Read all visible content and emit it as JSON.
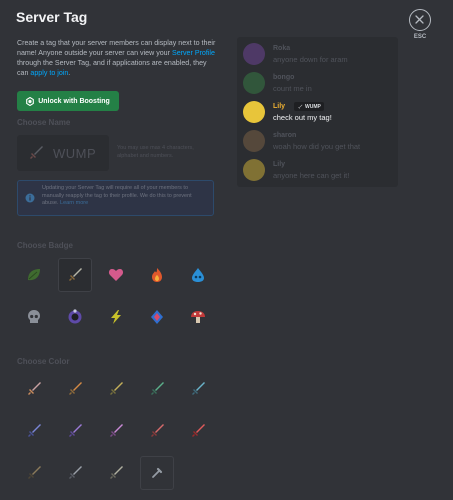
{
  "header": {
    "title": "Server Tag",
    "esc_label": "ESC"
  },
  "description": {
    "part1": "Create a tag that your server members can display next to their name! Anyone outside your server can view your ",
    "link1": "Server Profile",
    "part2": " through the Server Tag, and if applications are enabled, they can ",
    "link2": "apply to join",
    "part3": "."
  },
  "unlock_button": {
    "label": "Unlock with Boosting"
  },
  "choose_name": {
    "label": "Choose Name",
    "tag_text": "WUMP",
    "hint": "You may use max 4 characters, alphabet and numbers."
  },
  "info": {
    "text": "Updating your Server Tag will require all of your members to manually reapply the tag to their profile. We do this to prevent abuse. ",
    "link": "Learn more"
  },
  "choose_badge": {
    "label": "Choose Badge",
    "badges": [
      "leaf-icon",
      "sword-icon",
      "heart-icon",
      "fire-icon",
      "water-drop-icon",
      "skull-icon",
      "moon-icon",
      "lightning-icon",
      "crystal-icon",
      "mushroom-icon"
    ],
    "selected": "sword-icon",
    "badge_colors": [
      "#3f6b2f",
      "#8a8a78",
      "#d45a8c",
      "#e0582c",
      "#2a8fd6",
      "#8a8f98",
      "#5e4aa8",
      "#c8c22a",
      "#2f6fd0",
      "#c23a3a"
    ]
  },
  "choose_color": {
    "label": "Choose Color",
    "colors": [
      [
        "#c9a2a2",
        "#c98b5c"
      ],
      [
        "#d48a45",
        "#8c6a3a"
      ],
      [
        "#c4b05a",
        "#76703c"
      ],
      [
        "#5bb08a",
        "#3a6e5a"
      ],
      [
        "#6ab3c9",
        "#3e6a7a"
      ],
      [
        "#7a86d6",
        "#4a5396"
      ],
      [
        "#9b7bd6",
        "#5e4a96"
      ],
      [
        "#c98ad6",
        "#7a4a86"
      ],
      [
        "#d66a6a",
        "#8a3a3a"
      ],
      [
        "#e05a5a",
        "#9a2a2a"
      ],
      [
        "#8a7a5a",
        "#4e4636"
      ],
      [
        "#9aa0a8",
        "#5a5e66"
      ],
      [
        "#b0b0a0",
        "#6a6a5e"
      ]
    ],
    "custom_icon": "eyedropper-icon"
  },
  "preview": {
    "messages": [
      {
        "name": "Roka",
        "text": "anyone down for aram",
        "active": false,
        "avatar_color": "#7a4aa8"
      },
      {
        "name": "bongo",
        "text": "count me in",
        "active": false,
        "avatar_color": "#3a8a4a"
      },
      {
        "name": "Lily",
        "text": "check out my tag!",
        "active": true,
        "avatar_color": "#e8c53a"
      },
      {
        "name": "sharon",
        "text": "woah how did you get that",
        "active": false,
        "avatar_color": "#8a6a4a"
      },
      {
        "name": "Lily",
        "text": "anyone here can get it!",
        "active": false,
        "avatar_color": "#e8c53a"
      }
    ],
    "tag_label": "WUMP"
  }
}
